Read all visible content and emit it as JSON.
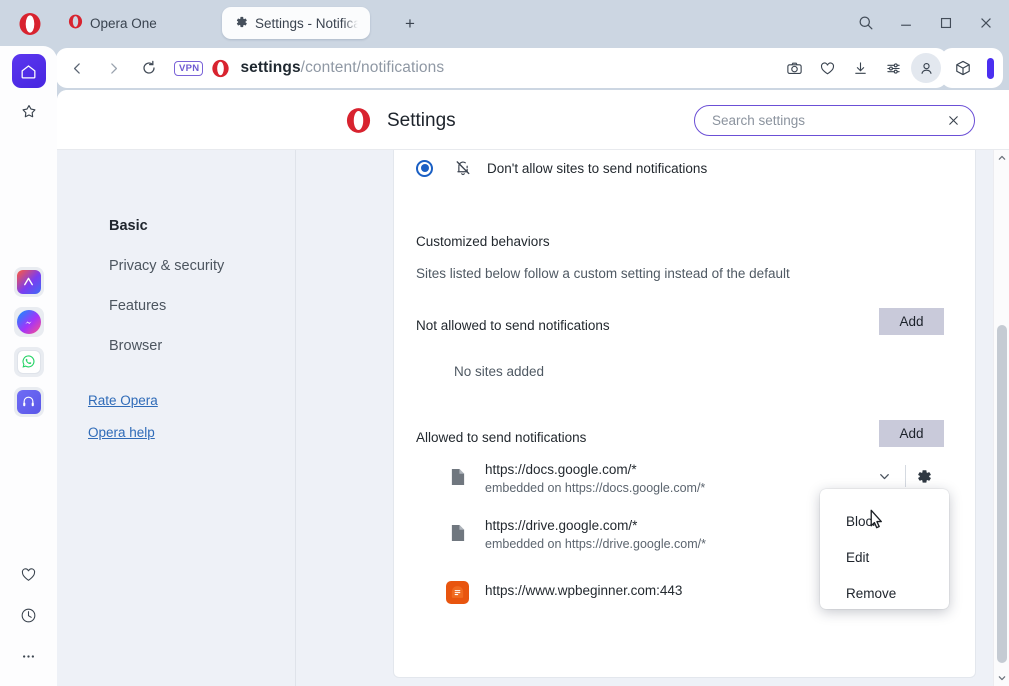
{
  "window": {
    "app_tab_label": "Opera One",
    "active_tab_label": "Settings - Notificat",
    "new_tab_tooltip": "+",
    "controls": {
      "search": "search-icon",
      "minimize": "minimize-icon",
      "maximize": "maximize-icon",
      "close": "close-icon"
    }
  },
  "address_bar": {
    "vpn_badge": "VPN",
    "url_bold": "settings",
    "url_rest": "/content/notifications",
    "icons": [
      "camera-icon",
      "heart-icon",
      "download-icon",
      "sliders-icon",
      "profile-icon",
      "extensions-cube-icon"
    ]
  },
  "rail": {
    "top": [
      "home-icon",
      "favorites-star-icon"
    ],
    "apps": [
      "aria-ai-icon",
      "messenger-icon",
      "whatsapp-icon",
      "music-player-icon"
    ],
    "bottom": [
      "heart-icon",
      "history-clock-icon",
      "more-menu-icon"
    ]
  },
  "settings_header": {
    "title": "Settings",
    "search_placeholder": "Search settings",
    "search_value": "",
    "clear_label": "×"
  },
  "sidebar": {
    "items": [
      {
        "label": "Basic",
        "active": true
      },
      {
        "label": "Privacy & security",
        "active": false
      },
      {
        "label": "Features",
        "active": false
      },
      {
        "label": "Browser",
        "active": false
      }
    ],
    "links": [
      {
        "label": "Rate Opera"
      },
      {
        "label": "Opera help"
      }
    ]
  },
  "main": {
    "default_setting": {
      "radio_label": "Don't allow sites to send notifications",
      "radio_selected": true,
      "icon": "bell-off-icon"
    },
    "customized_behaviors": {
      "title": "Customized behaviors",
      "description": "Sites listed below follow a custom setting instead of the default"
    },
    "blocked_section": {
      "title": "Not allowed to send notifications",
      "add_label": "Add",
      "empty_label": "No sites added"
    },
    "allowed_section": {
      "title": "Allowed to send notifications",
      "add_label": "Add",
      "sites": [
        {
          "url": "https://docs.google.com/*",
          "sub": "embedded on https://docs.google.com/*",
          "favicon": "document-icon"
        },
        {
          "url": "https://drive.google.com/*",
          "sub": "embedded on https://drive.google.com/*",
          "favicon": "document-icon"
        },
        {
          "url": "https://www.wpbeginner.com:443",
          "sub": "",
          "favicon": "wpbeginner-icon"
        }
      ]
    }
  },
  "context_menu": {
    "items": [
      {
        "label": "Block"
      },
      {
        "label": "Edit"
      },
      {
        "label": "Remove"
      }
    ]
  },
  "colors": {
    "chrome_bg": "#ccd6e2",
    "accent_purple": "#4b2ff0",
    "radio_blue": "#1a5fc4",
    "link_blue": "#2f6bb8",
    "add_button": "#c9cada",
    "opera_red": "#d8232f",
    "wpbeginner_orange": "#e8550f"
  }
}
